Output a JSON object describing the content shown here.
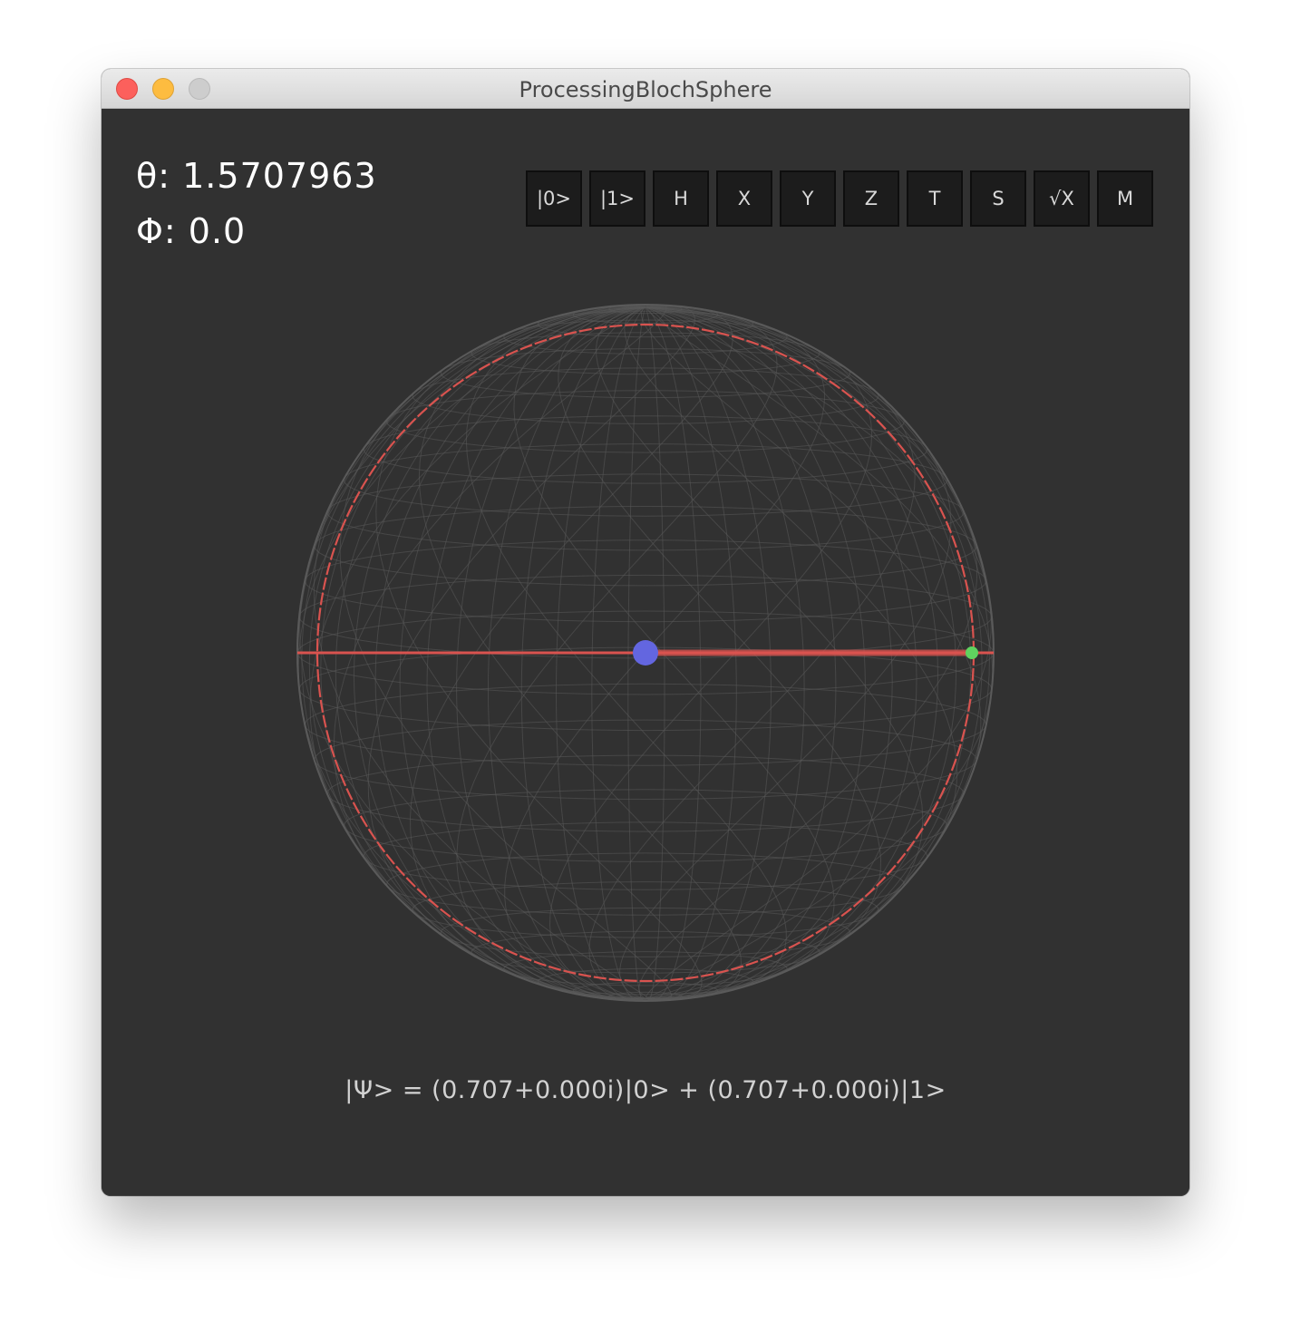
{
  "window": {
    "title": "ProcessingBlochSphere"
  },
  "readout": {
    "theta": "θ: 1.5707963",
    "phi": "Φ: 0.0"
  },
  "gates": [
    {
      "label": "|0>",
      "name": "gate-ket0-button"
    },
    {
      "label": "|1>",
      "name": "gate-ket1-button"
    },
    {
      "label": "H",
      "name": "gate-h-button"
    },
    {
      "label": "X",
      "name": "gate-x-button"
    },
    {
      "label": "Y",
      "name": "gate-y-button"
    },
    {
      "label": "Z",
      "name": "gate-z-button"
    },
    {
      "label": "T",
      "name": "gate-t-button"
    },
    {
      "label": "S",
      "name": "gate-s-button"
    },
    {
      "label": "√X",
      "name": "gate-sqrtx-button"
    },
    {
      "label": "M",
      "name": "gate-measure-button"
    }
  ],
  "state_vector": "|Ψ> = (0.707+0.000i)|0> + (0.707+0.000i)|1>",
  "colors": {
    "background": "#313131",
    "wireframe": "#5a5a5a",
    "axis": "#d9534f",
    "center": "#6366e0",
    "state_point": "#5fd35f"
  }
}
